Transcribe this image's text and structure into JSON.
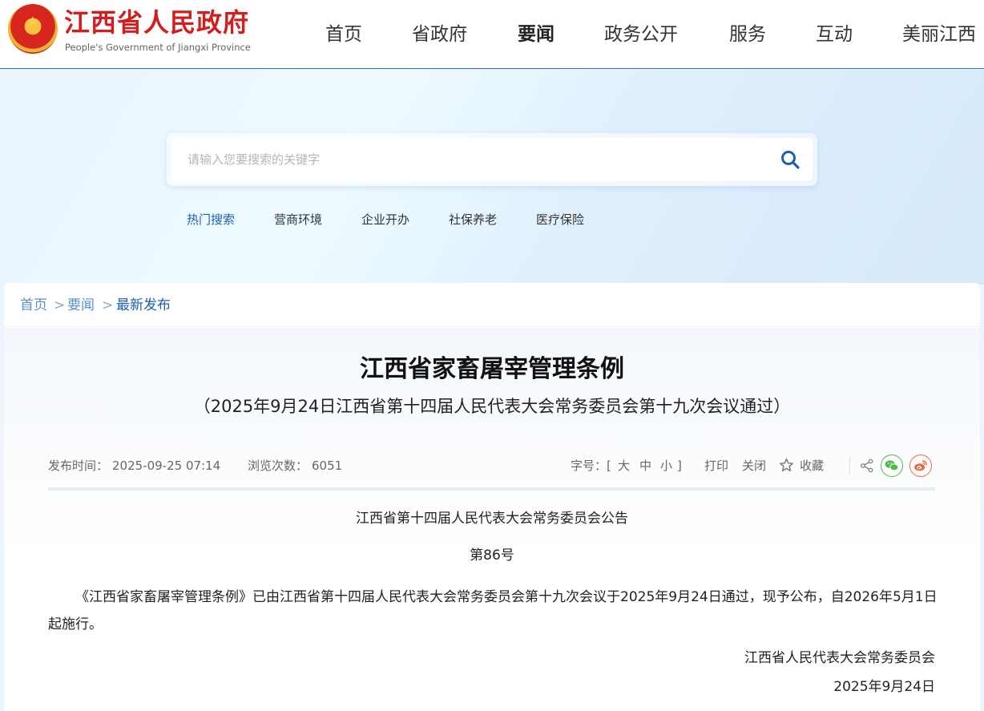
{
  "header": {
    "site_title": "江西省人民政府",
    "site_subtitle": "People's Government of Jiangxi Province",
    "nav": [
      {
        "label": "首页"
      },
      {
        "label": "省政府"
      },
      {
        "label": "要闻",
        "active": true
      },
      {
        "label": "政务公开"
      },
      {
        "label": "服务"
      },
      {
        "label": "互动"
      },
      {
        "label": "美丽江西"
      }
    ]
  },
  "search": {
    "placeholder": "请输入您要搜索的关键字",
    "hot_label": "热门搜索",
    "hot_items": [
      "营商环境",
      "企业开办",
      "社保养老",
      "医疗保险"
    ]
  },
  "breadcrumb": [
    "首页",
    "要闻",
    "最新发布"
  ],
  "article": {
    "title": "江西省家畜屠宰管理条例",
    "subtitle": "（2025年9月24日江西省第十四届人民代表大会常务委员会第十九次会议通过）",
    "publish_label": "发布时间：",
    "publish_time": "2025-09-25 07:14",
    "views_label": "浏览次数：",
    "views": "6051",
    "font_label": "字号：[",
    "font_large": "大",
    "font_medium": "中",
    "font_small": "小",
    "font_close": "]",
    "print": "打印",
    "close": "关闭",
    "favorite": "收藏",
    "announcement": "江西省第十四届人民代表大会常务委员会公告",
    "number": "第86号",
    "paragraph": "《江西省家畜屠宰管理条例》已由江西省第十四届人民代表大会常务委员会第十九次会议于2025年9月24日通过，现予公布，自2026年5月1日起施行。",
    "signature": "江西省人民代表大会常务委员会",
    "date": "2025年9月24日"
  },
  "colors": {
    "brand_red": "#d11f1f",
    "link_blue": "#1f5fa8",
    "wechat_green": "#55b84a",
    "weibo_orange": "#ea6a3c"
  },
  "icons": [
    "search-icon",
    "star-icon",
    "share-icon",
    "wechat-icon",
    "weibo-icon",
    "national-emblem-icon"
  ]
}
